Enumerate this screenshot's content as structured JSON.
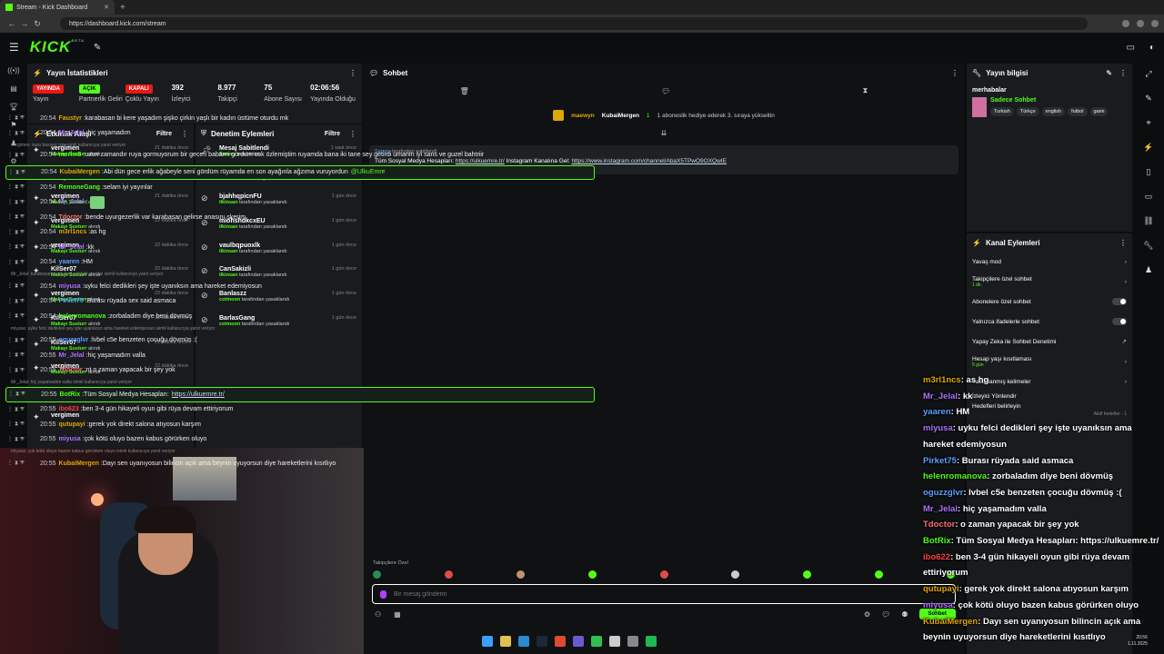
{
  "browser": {
    "tab_title": "Stream - Kick Dashboard",
    "url": "https://dashboard.kick.com/stream"
  },
  "brand": {
    "logo": "KICK",
    "beta": "BETA",
    "accent": "#53fc18"
  },
  "stats": {
    "title": "Yayın İstatistikleri",
    "items": [
      {
        "badge": "YAYINDA",
        "label": "Yayın"
      },
      {
        "badge": "AÇIK",
        "label": "Partnerlik Geliri"
      },
      {
        "badge": "KAPALI",
        "label": "Çoklu Yayın"
      },
      {
        "value": "392",
        "label": "İzleyici"
      },
      {
        "value": "8.977",
        "label": "Takipçi"
      },
      {
        "value": "75",
        "label": "Abone Sayısı"
      },
      {
        "value": "02:06:56",
        "label": "Yayında Olduğu"
      }
    ]
  },
  "activity": {
    "title": "Etkinlik Akışı",
    "filter": "Filtre",
    "items": [
      {
        "name": "vergimen",
        "sub": "Makayı Susturr",
        "suffix": "alındı",
        "time": "21 dakika önce"
      },
      {
        "name": "KilSer07",
        "sub": "Makayı Susturr",
        "suffix": "alındı",
        "time": "21 dakika önce"
      },
      {
        "name": "vergimen",
        "sub": "Makayı Susturr",
        "suffix": "alındı",
        "time": "21 dakika önce"
      },
      {
        "name": "vergimen",
        "sub": "Makayı Susturr",
        "suffix": "alındı",
        "time": "22 dakika önce"
      },
      {
        "name": "vergimen",
        "sub": "Makayı Susturr",
        "suffix": "alındı",
        "time": "22 dakika önce"
      },
      {
        "name": "KilSer07",
        "sub": "Makayı Susturr",
        "suffix": "alındı",
        "time": "22 dakika önce"
      },
      {
        "name": "vergimen",
        "sub": "Makayı Susturr",
        "suffix": "alındı",
        "time": "22 dakika önce"
      },
      {
        "name": "KilSer07",
        "sub": "Makayı Susturr",
        "suffix": "alındı",
        "time": "22 dakika önce"
      },
      {
        "name": "KilSer07",
        "sub": "Makayı Susturr",
        "suffix": "alındı",
        "time": "22 dakika önce"
      },
      {
        "name": "vergimen",
        "sub": "Makayı Susturr",
        "suffix": "alındı",
        "time": "22 dakika önce"
      },
      {
        "name": "KilSer07",
        "sub": "Makayı Susturr",
        "suffix": "alındı",
        "time": "22 dakika önce"
      },
      {
        "name": "vergimen",
        "sub": "",
        "suffix": "",
        "time": ""
      }
    ]
  },
  "moderation": {
    "title": "Denetim Eylemleri",
    "filter": "Filtre",
    "items": [
      {
        "name": "Mesaj Sabitlendi",
        "sub": "Sarney",
        "suffix": "tarafından",
        "time": "1 saat önce"
      },
      {
        "name": "tdrgrleeaoaJ",
        "sub": "ilkinsan",
        "suffix": "tarafından yasaklandı",
        "time": "1 gün önce"
      },
      {
        "name": "bjahhqpicnFU",
        "sub": "ilkinsan",
        "suffix": "tarafından yasaklandı",
        "time": "1 gün önce"
      },
      {
        "name": "miohshdkcxEU",
        "sub": "ilkinsan",
        "suffix": "tarafından yasaklandı",
        "time": "1 gün önce"
      },
      {
        "name": "vaulbqpuoxlk",
        "sub": "ilkinsan",
        "suffix": "tarafından yasaklandı",
        "time": "1 gün önce"
      },
      {
        "name": "CanSakizli",
        "sub": "ilkinsan",
        "suffix": "tarafından yasaklandı",
        "time": "1 gün önce"
      },
      {
        "name": "Banlaszz",
        "sub": "cotmoon",
        "suffix": "tarafından yasaklandı",
        "time": "1 gün önce"
      },
      {
        "name": "BarlasGang",
        "sub": "cotmoon",
        "suffix": "tarafından yasaklandı",
        "time": "1 gün önce"
      }
    ]
  },
  "chat": {
    "title": "Sohbet",
    "gift_user": "maewyn",
    "gift_target": "KubaiMergen",
    "gift_count": "1",
    "gift_text": "1 aboneslik hediye ederek 3. sıraya yükseltin",
    "pinned_by": "Sarney",
    "pinned_by_suffix": "tarafından sabitlendi",
    "pinned_text": "Tüm Sosyal Medya Hesapları:",
    "pinned_link1": "https://ulkuemre.tr/",
    "pinned_mid": "Instagram Kanalına Gel:",
    "pinned_link2": "https://www.instagram.com/channel/AbaX5TPwO9OXQwIE",
    "reply1": "vergimen: kara basıyor işte isimli kullanıcıya yanıt veriyor",
    "reply2": "Mr_Jelal: karabasan nedir tarif edebilir misiniz isimli kullanıcıya yanıt veriyor",
    "reply3": "miyusa: uyku felci dedikleri şey işte uyanıksın ama hareket edemiyosun isimli kullanıcıya yanıt veriyor",
    "reply4": "Mr_Jelal: hiç yaşamadım valla isimli kullanıcıya yanıt veriyor",
    "reply5": "miyusa: çok kötü oluyo bazen kabus görürken oluyo isimli kullanıcıya yanıt veriyor",
    "messages": [
      {
        "time": "20:54",
        "user": "Faustyr",
        "color": "#e0a800",
        "text": "karabasan bi kere yaşadım şişko çirkin yaşlı bir kadın üstüme oturdu mk"
      },
      {
        "time": "20:54",
        "user": "Mr_Jelal",
        "color": "#b070ff",
        "text": "hiç yaşamadım"
      },
      {
        "time": "20:54",
        "user": "merim8",
        "color": "#53fc18",
        "text": "uzun zamandır ruya gormuyorum bir gecen babami gordum cok özlemiştim ruyamda bana iki tane sey getirdi umarim iyi sans ve guzel bahtriir"
      },
      {
        "time": "20:54",
        "user": "KubaiMergen",
        "color": "#e0a800",
        "text": "Abi dün gece erlik ağabeyle seni gördüm rüyamda en son ayağınla ağzıma vuruyordun",
        "mention": "@UlkuEmre"
      },
      {
        "time": "20:54",
        "user": "RemoneGang",
        "color": "#53fc18",
        "text": "selam iyi yayınlar"
      },
      {
        "time": "20:54",
        "user": "Mr_Jelal",
        "color": "#b070ff",
        "text": ""
      },
      {
        "time": "20:54",
        "user": "Tdoctor",
        "color": "#ff7070",
        "text": "bende uyurgezerlik var karabasan gelirse anasını skerim"
      },
      {
        "time": "20:54",
        "user": "m3rl1ncs",
        "color": "#e0a800",
        "text": "as hg"
      },
      {
        "time": "20:54",
        "user": "Mr_Jelal",
        "color": "#b070ff",
        "text": "kk"
      },
      {
        "time": "20:54",
        "user": "yaaren",
        "color": "#5aa0ff",
        "text": "HM"
      },
      {
        "time": "20:54",
        "user": "miyusa",
        "color": "#b070ff",
        "text": "uyku felci dedikleri şey işte uyanıksın ama hareket edemiyosun"
      },
      {
        "time": "20:54",
        "user": "Pirket75",
        "color": "#5aa0ff",
        "text": "Burası rüyada sex said asmaca"
      },
      {
        "time": "20:54",
        "user": "helenromanova",
        "color": "#53fc18",
        "text": "zorbaladım diye beni dövmüş"
      },
      {
        "time": "20:55",
        "user": "oguzzglvr",
        "color": "#5aa0ff",
        "text": "lvbel c5e benzeten çocuğu dövmüş :("
      },
      {
        "time": "20:55",
        "user": "Mr_Jelal",
        "color": "#b070ff",
        "text": "hiç yaşamadım valla"
      },
      {
        "time": "20:55",
        "user": "Tdoctor",
        "color": "#ff7070",
        "text": "nt o zaman yapacak bir şey yok"
      },
      {
        "time": "20:55",
        "user": "BotRix",
        "color": "#53fc18",
        "text": "Tüm Sosyal Medya Hesapları:",
        "link": "https://ulkuemre.tr/"
      },
      {
        "time": "20:55",
        "user": "ibo623",
        "color": "#ff4040",
        "text": "ben 3-4 gün hikayeli oyun gibi rüya devam ettiriyorum"
      },
      {
        "time": "20:55",
        "user": "qutupayi",
        "color": "#e0a800",
        "text": "gerek yok direkt salona atıyosun karşım"
      },
      {
        "time": "20:55",
        "user": "miyusa",
        "color": "#b070ff",
        "text": "çok kötü oluyo bazen kabus görürken oluyo"
      },
      {
        "time": "20:55",
        "user": "KubaiMergen",
        "color": "#e0a800",
        "text": "Dayı sen uyanıyosun bilincin açık ama beynin uyuyorsun diye hareketlerini kısıtlıyo"
      }
    ],
    "followers_label": "Takipçilere Özel",
    "input_placeholder": "Bir mesaj gönderin",
    "send_label": "Sohbet"
  },
  "streaminfo": {
    "title": "Yayın bilgisi",
    "stream_title": "merhabalar",
    "category": "Sadece Sohbet",
    "tags": [
      "Turkish",
      "Türkçe",
      "english",
      "futbol",
      "gami"
    ]
  },
  "channel_actions": {
    "title": "Kanal Eylemleri",
    "items": [
      {
        "label": "Yavaş mod",
        "sub": "",
        "type": "arrow"
      },
      {
        "label": "Takipçilere özel sohbet",
        "sub": "1 dk.",
        "type": "arrow"
      },
      {
        "label": "Abonelere özel sohbet",
        "sub": "",
        "type": "toggle"
      },
      {
        "label": "Yalnızca ifadelerle sohbet",
        "sub": "",
        "type": "toggle"
      },
      {
        "label": "Yapay Zeka ile Sohbet Denetimi",
        "sub": "",
        "type": "link"
      },
      {
        "label": "Hesap yaşı kısıtlaması",
        "sub": "5 gün",
        "type": "arrow"
      },
      {
        "label": "Yasaklanmış kelimeler",
        "sub": "",
        "type": "arrow"
      },
      {
        "label": "İzleyici Yönlendir",
        "sub": "",
        "type": "none"
      },
      {
        "label": "Hedefleri belirleyin",
        "sub": "",
        "type": "none"
      }
    ],
    "active_goals": "Aktif hedefler - 1"
  },
  "overlay": [
    {
      "user": "m3rl1ncs",
      "color": "#e0a800",
      "text": ": as hg"
    },
    {
      "user": "Mr_Jelal",
      "color": "#b070ff",
      "text": ": kk"
    },
    {
      "user": "yaaren",
      "color": "#5aa0ff",
      "text": ": HM"
    },
    {
      "user": "miyusa",
      "color": "#b070ff",
      "text": ": uyku felci dedikleri şey işte uyanıksın ama hareket edemiyosun"
    },
    {
      "user": "Pirket75",
      "color": "#5aa0ff",
      "text": ": Burası rüyada  said asmaca"
    },
    {
      "user": "helenromanova",
      "color": "#53fc18",
      "text": ": zorbaladım diye beni dövmüş"
    },
    {
      "user": "oguzzglvr",
      "color": "#5aa0ff",
      "text": ": lvbel c5e benzeten çocuğu dövmüş :("
    },
    {
      "user": "Mr_Jelal",
      "color": "#b070ff",
      "text": ": hiç yaşamadım valla"
    },
    {
      "user": "Tdoctor",
      "color": "#ff7070",
      "text": ": o zaman yapacak bir şey yok"
    },
    {
      "user": "BotRix",
      "color": "#53fc18",
      "text": ": Tüm Sosyal Medya Hesapları: https://ulkuemre.tr/"
    },
    {
      "user": "ibo622",
      "color": "#ff4040",
      "text": ": ben 3-4 gün hikayeli oyun gibi rüya devam ettiriyorum"
    },
    {
      "user": "qutupayi",
      "color": "#e0a800",
      "text": ": gerek yok direkt salona atıyosun karşım"
    },
    {
      "user": "miyusa",
      "color": "#b070ff",
      "text": ": çok kötü oluyo bazen kabus görürken oluyo"
    },
    {
      "user": "KubaiMergen",
      "color": "#e0a800",
      "text": ": Dayı sen uyanıyosun bilincin açık ama beynin uyuyorsun diye hareketlerini kısıtlıyo"
    }
  ],
  "tray": {
    "time": "20:56",
    "date": "1.11.2025"
  }
}
